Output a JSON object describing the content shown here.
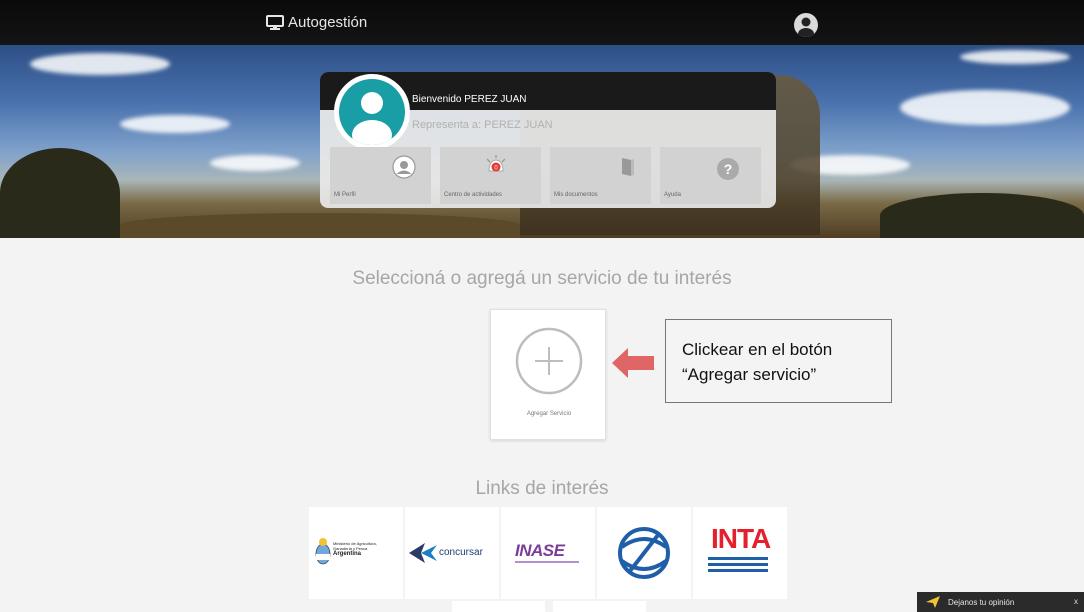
{
  "header": {
    "app_title": "Autogestión",
    "icons": {
      "app": "monitor-icon",
      "user": "user-avatar-icon"
    }
  },
  "welcome_card": {
    "greeting_prefix": "Bienvenido",
    "user_name": "PEREZ JUAN",
    "represents_label": "Representa a:",
    "represents_name": "PEREZ JUAN",
    "tiles": [
      {
        "label": "Mi Perfil",
        "icon": "profile-icon"
      },
      {
        "label": "Centro de actividades",
        "icon": "alarm-bell-icon",
        "badge": "0"
      },
      {
        "label": "Mis documentos",
        "icon": "book-icon"
      },
      {
        "label": "Ayuda",
        "icon": "help-icon"
      }
    ]
  },
  "services": {
    "title": "Seleccioná o agregá un servicio de tu interés",
    "add_label": "Agregar Servicio"
  },
  "callout": {
    "line1": "Clickear en el botón",
    "line2": "“Agregar servicio”"
  },
  "links": {
    "title": "Links de interés",
    "items": [
      {
        "name": "ministerio",
        "text_lines": [
          "Ministerio de Agricultura,",
          "Ganadería y Pesca",
          "Argentina"
        ]
      },
      {
        "name": "concursar",
        "text": "concursar"
      },
      {
        "name": "inase",
        "text": "INASE"
      },
      {
        "name": "fish-emblem",
        "icon": "fish-emblem-icon"
      },
      {
        "name": "inta",
        "text": "INTA"
      }
    ]
  },
  "feedback": {
    "label": "Dejanos tu opinión",
    "close": "x"
  },
  "colors": {
    "accent_teal": "#1a9ea5",
    "arrow_red": "#e06666",
    "inta_red": "#e3202b",
    "inta_blue": "#1f5fa8",
    "concursar_blue": "#1b7fc4"
  }
}
